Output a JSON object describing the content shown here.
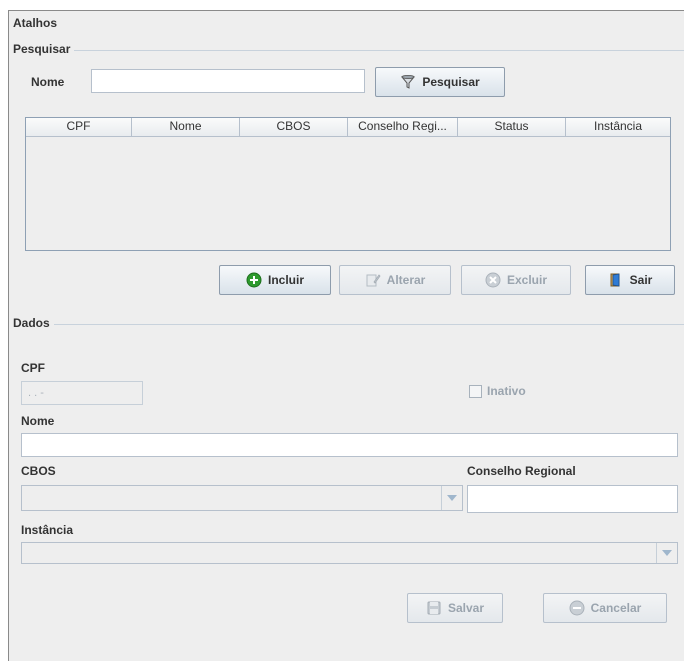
{
  "window": {
    "title": "Atalhos"
  },
  "search": {
    "group_label": "Pesquisar",
    "name_label": "Nome",
    "name_value": "",
    "search_button": "Pesquisar"
  },
  "table": {
    "columns": [
      "CPF",
      "Nome",
      "CBOS",
      "Conselho Regi...",
      "Status",
      "Instância"
    ],
    "rows": []
  },
  "actions": {
    "add": "Incluir",
    "edit": "Alterar",
    "delete": "Excluir",
    "exit": "Sair"
  },
  "details": {
    "group_label": "Dados",
    "cpf_label": "CPF",
    "cpf_value": " .  .  -",
    "inactive_label": "Inativo",
    "name_label": "Nome",
    "name_value": "",
    "cbos_label": "CBOS",
    "cbos_value": "",
    "council_label": "Conselho Regional",
    "council_value": "",
    "instance_label": "Instância",
    "instance_value": ""
  },
  "form_actions": {
    "save": "Salvar",
    "cancel": "Cancelar"
  },
  "colors": {
    "add_icon": "#2e9a2e",
    "exit_icon": "#2f7bd4"
  }
}
